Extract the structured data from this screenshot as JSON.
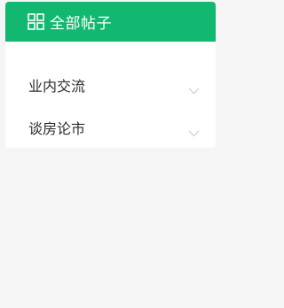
{
  "header": {
    "title": "全部帖子",
    "icon": "grid-icon"
  },
  "menu": {
    "items": [
      {
        "label": "业内交流",
        "icon": "chevron-down-icon"
      },
      {
        "label": "谈房论市",
        "icon": "chevron-down-icon"
      }
    ]
  },
  "colors": {
    "accent": "#12b870",
    "background": "#f5f5f5",
    "panel": "#ffffff",
    "text": "#2b2b2b",
    "chevron": "#cccccc"
  }
}
